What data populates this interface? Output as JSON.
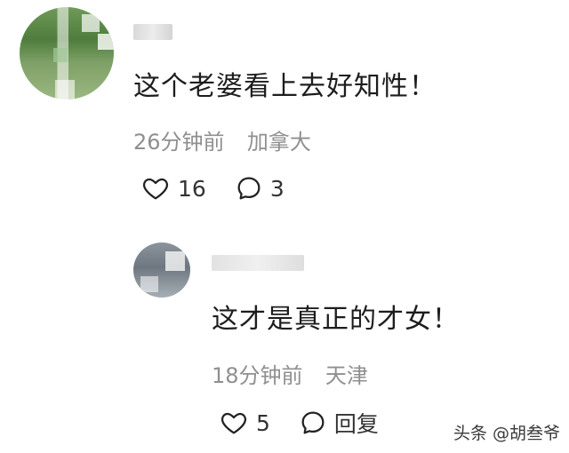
{
  "main_comment": {
    "text": "这个老婆看上去好知性！",
    "time": "26分钟前",
    "location": "加拿大",
    "like_count": "16",
    "reply_count": "3"
  },
  "reply_comment": {
    "text": "这才是真正的才女！",
    "time": "18分钟前",
    "location": "天津",
    "like_count": "5",
    "reply_label": "回复"
  },
  "watermark": "头条 @胡叁爷",
  "icons": {
    "like": "heart-outline-icon",
    "comment": "chat-bubble-icon"
  },
  "colors": {
    "text": "#1d1d1d",
    "meta": "#8f8f8f",
    "icon": "#222222"
  }
}
